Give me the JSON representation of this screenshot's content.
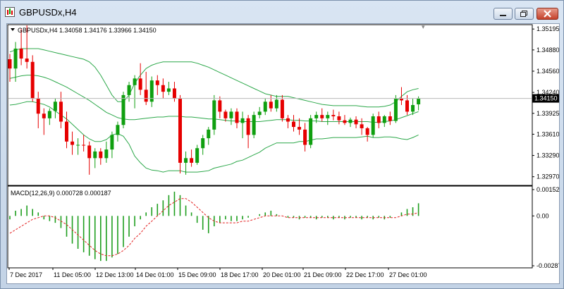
{
  "window": {
    "title": "GBPUSDx,H4"
  },
  "price_panel": {
    "header": "GBPUSDx,H4  1.34058 1.34176 1.33966 1.34150",
    "current_price": "1.34150",
    "y_ticks": [
      "1.35195",
      "1.34880",
      "1.34560",
      "1.34240",
      "1.33925",
      "1.33610",
      "1.33290",
      "1.32970"
    ]
  },
  "macd_panel": {
    "header": "MACD(12,26,9) 0.000728 0.000187",
    "y_ticks": [
      "0.001524",
      "0.00",
      "-0.002875"
    ]
  },
  "x_axis": {
    "labels": [
      "7 Dec 2017",
      "11 Dec 05:00",
      "12 Dec 13:00",
      "14 Dec 01:00",
      "15 Dec 09:00",
      "18 Dec 17:00",
      "20 Dec 01:00",
      "21 Dec 09:00",
      "22 Dec 17:00",
      "27 Dec 01:00"
    ]
  },
  "colors": {
    "bull": "#0f9f0f",
    "bear": "#e60000",
    "bands": "#2ca84a",
    "macd_hist": "#1e9e1e",
    "macd_signal": "#e32020"
  },
  "chart_data": {
    "type": "candlestick",
    "symbol": "GBPUSDx",
    "timeframe": "H4",
    "ylim": [
      1.3285,
      1.3525
    ],
    "candles": [
      {
        "o": 1.3474,
        "h": 1.3482,
        "l": 1.344,
        "c": 1.346
      },
      {
        "o": 1.346,
        "h": 1.35,
        "l": 1.344,
        "c": 1.349
      },
      {
        "o": 1.349,
        "h": 1.352,
        "l": 1.3465,
        "c": 1.3475
      },
      {
        "o": 1.3475,
        "h": 1.3525,
        "l": 1.346,
        "c": 1.347
      },
      {
        "o": 1.347,
        "h": 1.348,
        "l": 1.341,
        "c": 1.3415
      },
      {
        "o": 1.3415,
        "h": 1.3425,
        "l": 1.337,
        "c": 1.3392
      },
      {
        "o": 1.3392,
        "h": 1.34,
        "l": 1.336,
        "c": 1.3385
      },
      {
        "o": 1.3385,
        "h": 1.34,
        "l": 1.3375,
        "c": 1.3396
      },
      {
        "o": 1.3396,
        "h": 1.3415,
        "l": 1.3385,
        "c": 1.341
      },
      {
        "o": 1.341,
        "h": 1.3425,
        "l": 1.337,
        "c": 1.338
      },
      {
        "o": 1.338,
        "h": 1.3395,
        "l": 1.334,
        "c": 1.335
      },
      {
        "o": 1.335,
        "h": 1.3365,
        "l": 1.333,
        "c": 1.3345
      },
      {
        "o": 1.3345,
        "h": 1.3355,
        "l": 1.333,
        "c": 1.3345
      },
      {
        "o": 1.3345,
        "h": 1.336,
        "l": 1.3335,
        "c": 1.3344
      },
      {
        "o": 1.3344,
        "h": 1.335,
        "l": 1.33,
        "c": 1.3325
      },
      {
        "o": 1.3325,
        "h": 1.334,
        "l": 1.331,
        "c": 1.3335
      },
      {
        "o": 1.3335,
        "h": 1.334,
        "l": 1.3315,
        "c": 1.3325
      },
      {
        "o": 1.3325,
        "h": 1.335,
        "l": 1.3318,
        "c": 1.3338
      },
      {
        "o": 1.3338,
        "h": 1.3365,
        "l": 1.3325,
        "c": 1.336
      },
      {
        "o": 1.336,
        "h": 1.338,
        "l": 1.335,
        "c": 1.3375
      },
      {
        "o": 1.3375,
        "h": 1.3425,
        "l": 1.337,
        "c": 1.342
      },
      {
        "o": 1.342,
        "h": 1.344,
        "l": 1.341,
        "c": 1.3435
      },
      {
        "o": 1.3435,
        "h": 1.345,
        "l": 1.34,
        "c": 1.3445
      },
      {
        "o": 1.3445,
        "h": 1.3468,
        "l": 1.342,
        "c": 1.3428
      },
      {
        "o": 1.3428,
        "h": 1.3455,
        "l": 1.3405,
        "c": 1.341
      },
      {
        "o": 1.341,
        "h": 1.3448,
        "l": 1.3402,
        "c": 1.3442
      },
      {
        "o": 1.3442,
        "h": 1.345,
        "l": 1.342,
        "c": 1.3435
      },
      {
        "o": 1.3435,
        "h": 1.3445,
        "l": 1.3415,
        "c": 1.3425
      },
      {
        "o": 1.3425,
        "h": 1.344,
        "l": 1.342,
        "c": 1.343
      },
      {
        "o": 1.343,
        "h": 1.344,
        "l": 1.341,
        "c": 1.3415
      },
      {
        "o": 1.3415,
        "h": 1.342,
        "l": 1.3302,
        "c": 1.3318
      },
      {
        "o": 1.3318,
        "h": 1.3335,
        "l": 1.33,
        "c": 1.3325
      },
      {
        "o": 1.3325,
        "h": 1.3338,
        "l": 1.3312,
        "c": 1.3318
      },
      {
        "o": 1.3318,
        "h": 1.3345,
        "l": 1.3315,
        "c": 1.334
      },
      {
        "o": 1.334,
        "h": 1.336,
        "l": 1.333,
        "c": 1.3355
      },
      {
        "o": 1.3355,
        "h": 1.3372,
        "l": 1.3345,
        "c": 1.3368
      },
      {
        "o": 1.3368,
        "h": 1.342,
        "l": 1.336,
        "c": 1.3412
      },
      {
        "o": 1.3412,
        "h": 1.3418,
        "l": 1.3385,
        "c": 1.3395
      },
      {
        "o": 1.3395,
        "h": 1.3398,
        "l": 1.338,
        "c": 1.3385
      },
      {
        "o": 1.3385,
        "h": 1.34,
        "l": 1.3375,
        "c": 1.3395
      },
      {
        "o": 1.3395,
        "h": 1.34,
        "l": 1.337,
        "c": 1.3378
      },
      {
        "o": 1.3378,
        "h": 1.3395,
        "l": 1.3355,
        "c": 1.3385
      },
      {
        "o": 1.3385,
        "h": 1.339,
        "l": 1.334,
        "c": 1.336
      },
      {
        "o": 1.336,
        "h": 1.3395,
        "l": 1.3355,
        "c": 1.339
      },
      {
        "o": 1.339,
        "h": 1.3402,
        "l": 1.3385,
        "c": 1.3395
      },
      {
        "o": 1.3395,
        "h": 1.3415,
        "l": 1.339,
        "c": 1.341
      },
      {
        "o": 1.341,
        "h": 1.342,
        "l": 1.3395,
        "c": 1.34
      },
      {
        "o": 1.34,
        "h": 1.342,
        "l": 1.3395,
        "c": 1.3413
      },
      {
        "o": 1.3413,
        "h": 1.342,
        "l": 1.338,
        "c": 1.3385
      },
      {
        "o": 1.3385,
        "h": 1.339,
        "l": 1.337,
        "c": 1.338
      },
      {
        "o": 1.338,
        "h": 1.339,
        "l": 1.3365,
        "c": 1.3372
      },
      {
        "o": 1.3372,
        "h": 1.3385,
        "l": 1.336,
        "c": 1.3368
      },
      {
        "o": 1.3368,
        "h": 1.3378,
        "l": 1.3335,
        "c": 1.3345
      },
      {
        "o": 1.3345,
        "h": 1.339,
        "l": 1.334,
        "c": 1.3385
      },
      {
        "o": 1.3385,
        "h": 1.3395,
        "l": 1.3378,
        "c": 1.339
      },
      {
        "o": 1.339,
        "h": 1.34,
        "l": 1.338,
        "c": 1.3385
      },
      {
        "o": 1.3385,
        "h": 1.3395,
        "l": 1.3375,
        "c": 1.339
      },
      {
        "o": 1.339,
        "h": 1.3398,
        "l": 1.3382,
        "c": 1.3388
      },
      {
        "o": 1.3388,
        "h": 1.3395,
        "l": 1.3376,
        "c": 1.3382
      },
      {
        "o": 1.3382,
        "h": 1.339,
        "l": 1.3375,
        "c": 1.3378
      },
      {
        "o": 1.3378,
        "h": 1.3386,
        "l": 1.3372,
        "c": 1.3383
      },
      {
        "o": 1.3383,
        "h": 1.3388,
        "l": 1.337,
        "c": 1.3376
      },
      {
        "o": 1.3376,
        "h": 1.3385,
        "l": 1.336,
        "c": 1.337
      },
      {
        "o": 1.337,
        "h": 1.3372,
        "l": 1.335,
        "c": 1.336
      },
      {
        "o": 1.336,
        "h": 1.3392,
        "l": 1.3356,
        "c": 1.3388
      },
      {
        "o": 1.3388,
        "h": 1.3395,
        "l": 1.337,
        "c": 1.3378
      },
      {
        "o": 1.3378,
        "h": 1.339,
        "l": 1.3372,
        "c": 1.3388
      },
      {
        "o": 1.3388,
        "h": 1.3395,
        "l": 1.3375,
        "c": 1.3381
      },
      {
        "o": 1.3381,
        "h": 1.342,
        "l": 1.3378,
        "c": 1.3415
      },
      {
        "o": 1.3415,
        "h": 1.3432,
        "l": 1.3405,
        "c": 1.3412
      },
      {
        "o": 1.3412,
        "h": 1.342,
        "l": 1.339,
        "c": 1.3395
      },
      {
        "o": 1.3395,
        "h": 1.3415,
        "l": 1.339,
        "c": 1.3405
      },
      {
        "o": 1.3406,
        "h": 1.3418,
        "l": 1.3397,
        "c": 1.3415
      }
    ],
    "bollinger": {
      "upper": [
        1.3485,
        1.3488,
        1.349,
        1.349,
        1.349,
        1.349,
        1.3488,
        1.3486,
        1.3484,
        1.3482,
        1.348,
        1.3478,
        1.3476,
        1.3474,
        1.347,
        1.3462,
        1.345,
        1.3435,
        1.342,
        1.341,
        1.341,
        1.342,
        1.3438,
        1.345,
        1.346,
        1.3465,
        1.3468,
        1.347,
        1.347,
        1.347,
        1.347,
        1.347,
        1.347,
        1.3468,
        1.3465,
        1.3462,
        1.3458,
        1.3454,
        1.345,
        1.3446,
        1.3442,
        1.3438,
        1.3434,
        1.343,
        1.3426,
        1.3422,
        1.342,
        1.3418,
        1.3418,
        1.3418,
        1.3416,
        1.3414,
        1.3412,
        1.341,
        1.3408,
        1.3406,
        1.3405,
        1.3404,
        1.3404,
        1.3404,
        1.3404,
        1.3404,
        1.3403,
        1.3402,
        1.3402,
        1.3402,
        1.3403,
        1.3405,
        1.341,
        1.3418,
        1.3425,
        1.3428,
        1.343
      ],
      "middle": [
        1.3445,
        1.3447,
        1.3449,
        1.345,
        1.345,
        1.3449,
        1.3447,
        1.3444,
        1.344,
        1.3436,
        1.3432,
        1.3427,
        1.3422,
        1.3417,
        1.3412,
        1.3406,
        1.34,
        1.3394,
        1.339,
        1.3386,
        1.3384,
        1.3383,
        1.3383,
        1.3384,
        1.3385,
        1.3386,
        1.3387,
        1.3387,
        1.3388,
        1.3388,
        1.3388,
        1.3387,
        1.3387,
        1.3386,
        1.3385,
        1.3384,
        1.3384,
        1.3383,
        1.3382,
        1.3381,
        1.3381,
        1.338,
        1.338,
        1.338,
        1.338,
        1.3381,
        1.3382,
        1.3383,
        1.3383,
        1.3383,
        1.3382,
        1.3382,
        1.3381,
        1.3381,
        1.3381,
        1.338,
        1.338,
        1.338,
        1.338,
        1.338,
        1.338,
        1.338,
        1.338,
        1.338,
        1.3379,
        1.3379,
        1.338,
        1.3381,
        1.3383,
        1.3386,
        1.3389,
        1.3392,
        1.3395
      ],
      "lower": [
        1.3405,
        1.3406,
        1.3408,
        1.341,
        1.341,
        1.3408,
        1.3406,
        1.3402,
        1.3396,
        1.339,
        1.3384,
        1.3376,
        1.3368,
        1.336,
        1.3354,
        1.335,
        1.335,
        1.3353,
        1.336,
        1.3362,
        1.3358,
        1.3346,
        1.3328,
        1.3318,
        1.331,
        1.3307,
        1.3306,
        1.3304,
        1.3306,
        1.3306,
        1.3306,
        1.3304,
        1.3304,
        1.3304,
        1.3305,
        1.3306,
        1.331,
        1.3312,
        1.3314,
        1.3316,
        1.332,
        1.3322,
        1.3326,
        1.333,
        1.3334,
        1.334,
        1.3344,
        1.3348,
        1.3348,
        1.3348,
        1.3348,
        1.335,
        1.335,
        1.3352,
        1.3354,
        1.3354,
        1.3355,
        1.3356,
        1.3356,
        1.3356,
        1.3356,
        1.3356,
        1.3357,
        1.3358,
        1.3356,
        1.3356,
        1.3357,
        1.3357,
        1.3356,
        1.3354,
        1.3353,
        1.3356,
        1.336
      ]
    },
    "macd": {
      "ylim": [
        -0.003,
        0.0016
      ],
      "histogram": [
        -0.0002,
        0.0003,
        0.0004,
        0.0006,
        0.0004,
        0.0002,
        -0.0002,
        -0.0003,
        -0.0004,
        -0.0007,
        -0.0012,
        -0.0016,
        -0.0019,
        -0.0021,
        -0.0023,
        -0.0025,
        -0.0026,
        -0.0026,
        -0.0024,
        -0.0022,
        -0.0018,
        -0.0012,
        -0.0006,
        -0.0002,
        0.0002,
        0.0005,
        0.0007,
        0.0009,
        0.0012,
        0.0014,
        0.0012,
        0.0006,
        0.0002,
        -0.0004,
        -0.0008,
        -0.001,
        -0.0006,
        -0.0004,
        -0.0002,
        -0.0003,
        -0.0003,
        -0.0002,
        -0.0001,
        0.0,
        0.0001,
        0.0002,
        0.0003,
        0.0001,
        0.0,
        -0.0001,
        -0.0001,
        -0.0002,
        -0.0001,
        -0.0001,
        -0.0002,
        -0.0001,
        -0.0001,
        -0.0002,
        -0.0001,
        -0.0002,
        -0.0001,
        -0.0001,
        -0.0002,
        -0.0001,
        -0.0002,
        -0.0001,
        -0.0002,
        -0.0001,
        0.0,
        0.0002,
        0.0004,
        0.0005,
        0.00073
      ],
      "signal": [
        -0.001,
        -0.0008,
        -0.0006,
        -0.0004,
        -0.0002,
        -0.0001,
        0.0,
        0.0,
        -0.0001,
        -0.0003,
        -0.0005,
        -0.0008,
        -0.0011,
        -0.0014,
        -0.0017,
        -0.002,
        -0.0022,
        -0.0023,
        -0.0023,
        -0.0022,
        -0.002,
        -0.0017,
        -0.0013,
        -0.001,
        -0.0006,
        -0.0003,
        0.0,
        0.0003,
        0.0006,
        0.0008,
        0.001,
        0.001,
        0.0008,
        0.0005,
        0.0002,
        -0.0001,
        -0.0003,
        -0.0004,
        -0.0004,
        -0.0004,
        -0.0004,
        -0.0003,
        -0.0003,
        -0.0002,
        -0.0001,
        0.0,
        0.0,
        0.0,
        0.0,
        -0.0001,
        -0.0001,
        -0.0001,
        -0.0001,
        -0.0001,
        -0.0001,
        -0.0001,
        -0.0001,
        -0.0001,
        -0.0001,
        -0.0001,
        -0.0001,
        -0.0001,
        -0.0001,
        -0.0001,
        -0.0001,
        -0.0001,
        -0.0001,
        -0.0001,
        -0.0001,
        0.0,
        0.0001,
        0.0001,
        0.000187
      ]
    }
  }
}
